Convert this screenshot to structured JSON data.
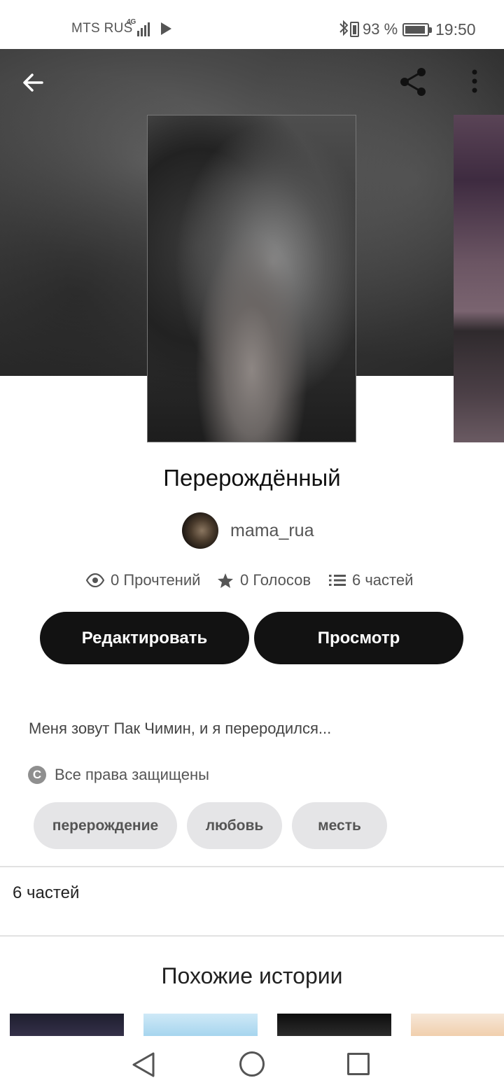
{
  "status_bar": {
    "carrier": "MTS RUS",
    "network": "4G",
    "battery_percent": "93 %",
    "time": "19:50"
  },
  "header": {
    "back_icon": "arrow-left-icon",
    "share_icon": "share-icon",
    "more_icon": "more-vertical-icon"
  },
  "story": {
    "title": "Перерождённый",
    "author": "mama_rua",
    "stats": {
      "reads": "0 Прочтений",
      "votes": "0 Голосов",
      "parts": "6 частей"
    },
    "edit_label": "Редактировать",
    "preview_label": "Просмотр",
    "description": "Меня зовут Пак Чимин, и я переродился...",
    "copyright": "Все права защищены",
    "tags": [
      "перерождение",
      "любовь",
      "месть"
    ],
    "parts_count_label": "6 частей"
  },
  "similar": {
    "title": "Похожие истории"
  },
  "colors": {
    "button_bg": "#121212",
    "tag_bg": "#e5e5e7",
    "divider": "#e2e2e2"
  }
}
